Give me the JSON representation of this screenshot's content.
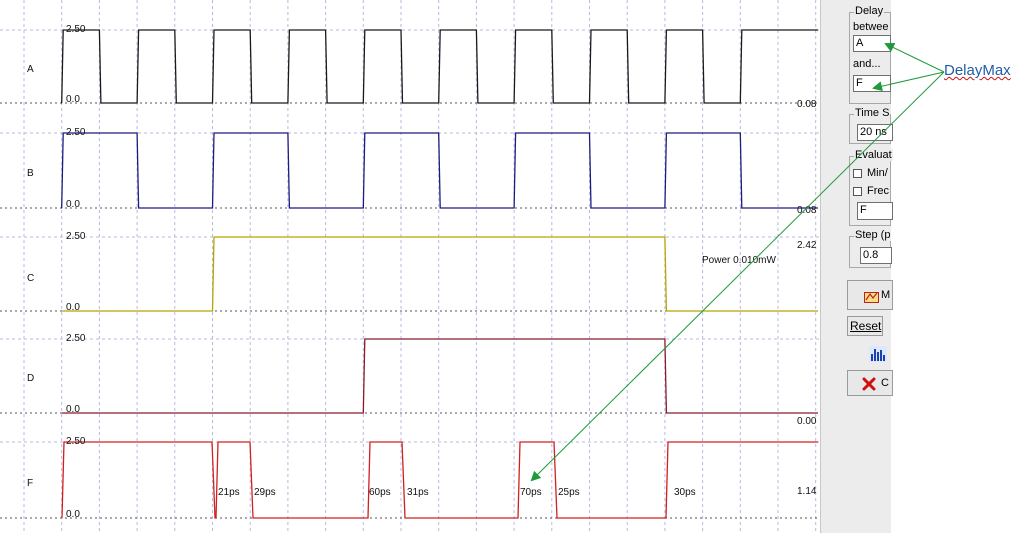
{
  "waveform": {
    "channels": [
      {
        "id": "A",
        "high_label": "2.50",
        "low_label": "0.0",
        "right_value": "0.08",
        "color": "#1a1a1a"
      },
      {
        "id": "B",
        "high_label": "2.50",
        "low_label": "0.0",
        "right_value": "0.08",
        "color": "#1c1c80"
      },
      {
        "id": "C",
        "high_label": "2.50",
        "low_label": "0.0",
        "right_value": "2.42",
        "color": "#b8a400"
      },
      {
        "id": "D",
        "high_label": "2.50",
        "low_label": "0.0",
        "right_value": "0.00",
        "color": "#8a1a2a"
      },
      {
        "id": "F",
        "high_label": "2.50",
        "low_label": "0.0",
        "right_value": "1.14",
        "color": "#d02020"
      }
    ],
    "power_label": "Power 0.010mW",
    "delay_labels": [
      "21ps",
      "29ps",
      "60ps",
      "31ps",
      "70ps",
      "25ps",
      "30ps"
    ]
  },
  "panel": {
    "delay_title": "Delay",
    "between_label": "betwee",
    "between_value": "A",
    "and_label": "and...",
    "and_value": "F",
    "time_scale_title": "Time S",
    "time_scale_value": "20 ns",
    "evaluate_title": "Evaluat",
    "minmax_label": "Min/",
    "freq_label": "Frec",
    "eval_value": "F",
    "step_title": "Step (p",
    "step_value": "0.8",
    "measure_label": "M",
    "reset_label": "Reset",
    "close_label": "C"
  },
  "annotation": {
    "text": "DelayMax",
    "color": "#1f5ea8",
    "arrow_color": "#1e9a3a"
  },
  "icons": [
    "measure-icon",
    "histogram-icon",
    "close-x-icon"
  ]
}
